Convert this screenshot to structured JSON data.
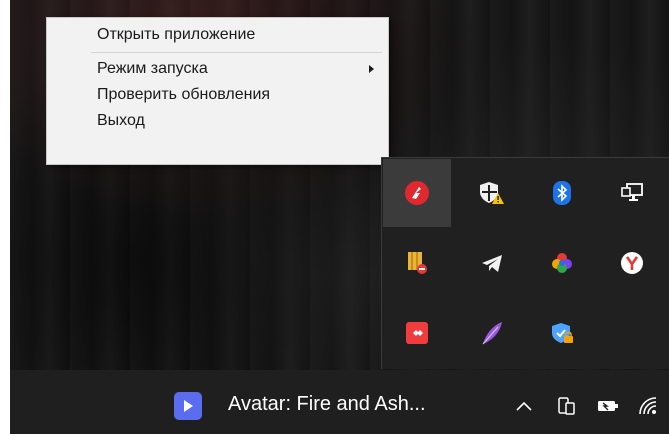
{
  "context_menu": {
    "items": [
      {
        "label": "Открыть приложение"
      },
      {
        "label": "Режим запуска",
        "has_submenu": true
      },
      {
        "label": "Проверить обновления"
      },
      {
        "label": "Выход"
      }
    ]
  },
  "tray_flyout": {
    "icons": [
      {
        "name": "red-app-icon",
        "active": true
      },
      {
        "name": "windows-security-warning-icon"
      },
      {
        "name": "bluetooth-icon"
      },
      {
        "name": "network-monitor-icon"
      },
      {
        "name": "yellow-shield-blocked-icon"
      },
      {
        "name": "telegram-icon"
      },
      {
        "name": "color-wheel-icon"
      },
      {
        "name": "yandex-browser-icon"
      },
      {
        "name": "anydesk-icon"
      },
      {
        "name": "feather-icon"
      },
      {
        "name": "shield-lock-icon"
      }
    ]
  },
  "taskbar": {
    "media_title": "Avatar: Fire and Ash...",
    "icons": [
      "chevron-up-icon",
      "phone-link-icon",
      "battery-icon",
      "wifi-icon"
    ]
  },
  "colors": {
    "menu_bg": "#f2f2f2",
    "tray_bg": "#202020",
    "taskbar_bg": "#1f1f1f",
    "media_accent": "#5a6df0"
  }
}
